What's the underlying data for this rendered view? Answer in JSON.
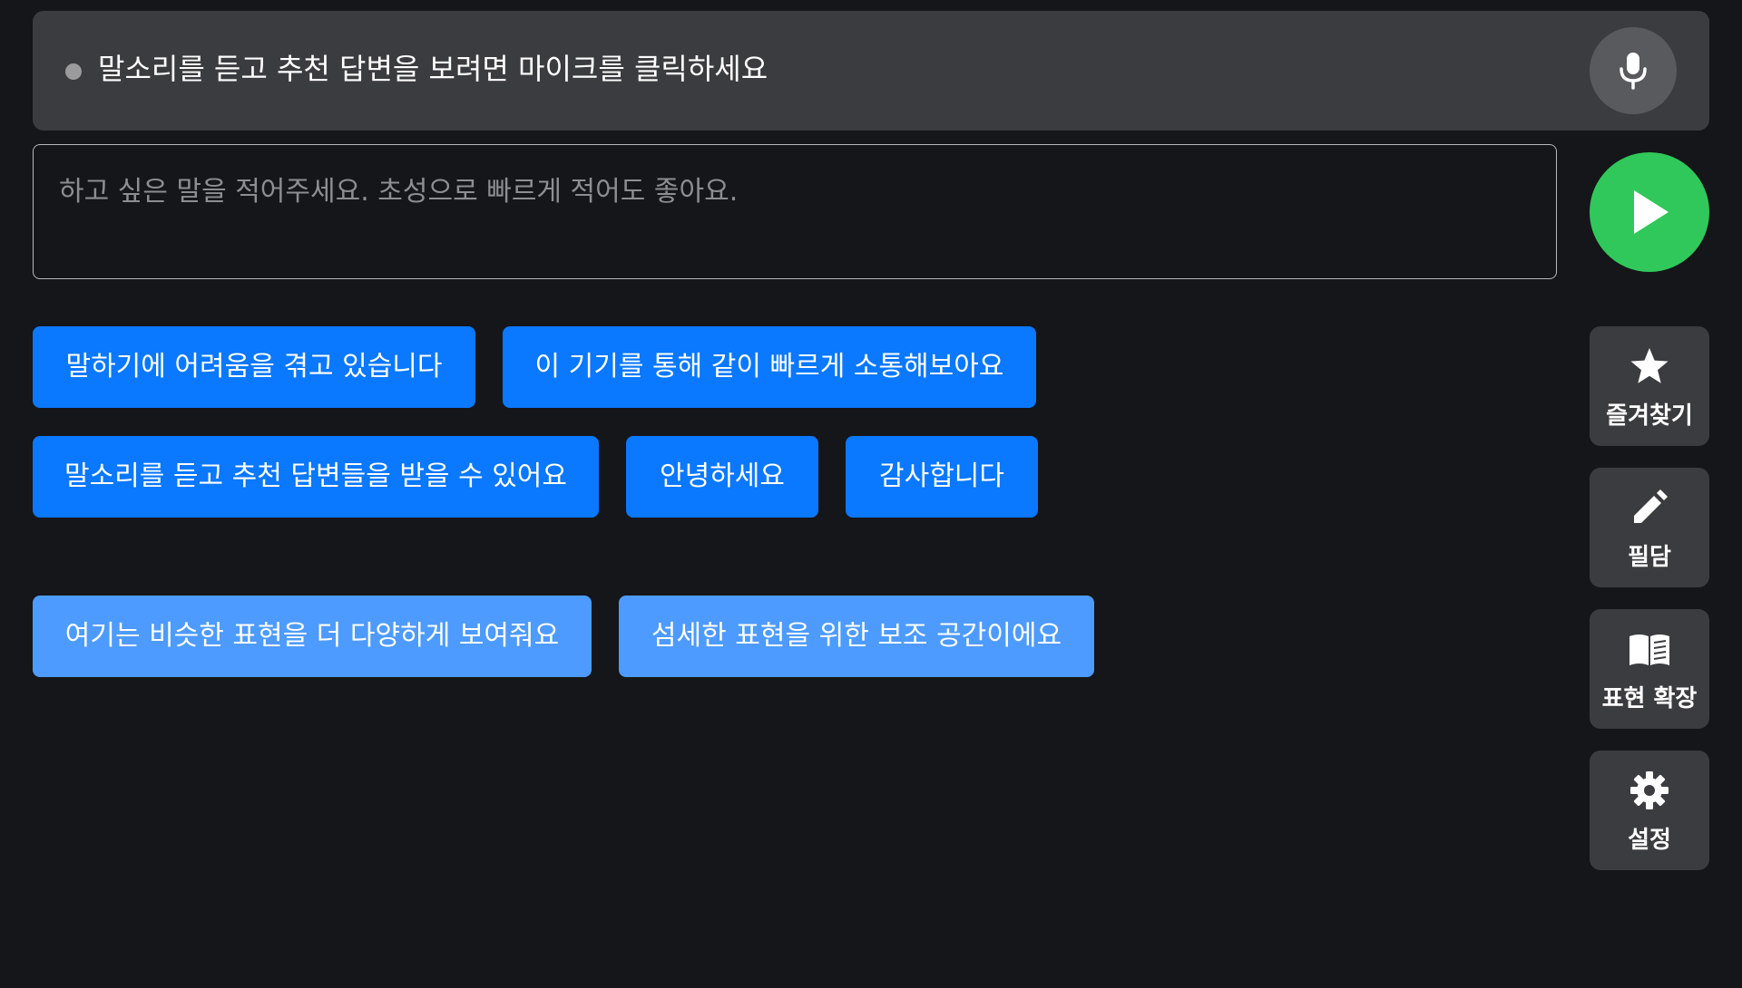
{
  "status": {
    "text": "말소리를 듣고 추천 답변을 보려면 마이크를 클릭하세요",
    "indicator": "idle"
  },
  "mic_button": {
    "icon": "microphone-icon"
  },
  "input": {
    "placeholder": "하고 싶은 말을 적어주세요. 초성으로 빠르게 적어도 좋아요.",
    "value": ""
  },
  "send_button": {
    "icon": "play-icon"
  },
  "suggestions": [
    "말하기에 어려움을 겪고 있습니다",
    "이 기기를 통해 같이 빠르게 소통해보아요",
    "말소리를 듣고 추천 답변들을 받을 수 있어요",
    "안녕하세요",
    "감사합니다"
  ],
  "expansions": [
    "여기는 비슷한 표현을 더 다양하게 보여줘요",
    "섬세한 표현을 위한 보조 공간이에요"
  ],
  "side_menu": {
    "favorites": {
      "label": "즐겨찾기",
      "icon": "star-icon"
    },
    "writing": {
      "label": "필담",
      "icon": "pencil-icon"
    },
    "expand": {
      "label": "표현 확장",
      "icon": "book-icon"
    },
    "settings": {
      "label": "설정",
      "icon": "gear-icon"
    }
  },
  "colors": {
    "background": "#151619",
    "panel": "#3b3c3f",
    "primary_button": "#0a78ff",
    "secondary_button": "#4d9bff",
    "send": "#30c85a"
  }
}
